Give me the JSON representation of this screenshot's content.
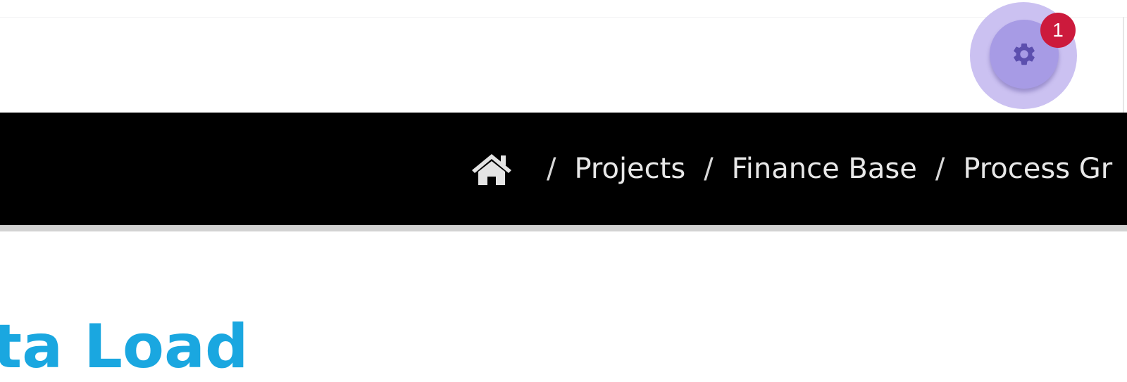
{
  "header": {
    "settings_icon": "gear-icon",
    "notification_count": "1",
    "colors": {
      "settings_halo": "#cbc1f1",
      "settings_button": "#a79be5",
      "badge": "#cc1a3c"
    }
  },
  "breadcrumb": {
    "home_icon": "home-icon",
    "separator": "/",
    "items": [
      "Projects",
      "Finance Base",
      "Process Gr"
    ]
  },
  "page": {
    "title": "ta Load",
    "title_color": "#1aa7e0"
  }
}
